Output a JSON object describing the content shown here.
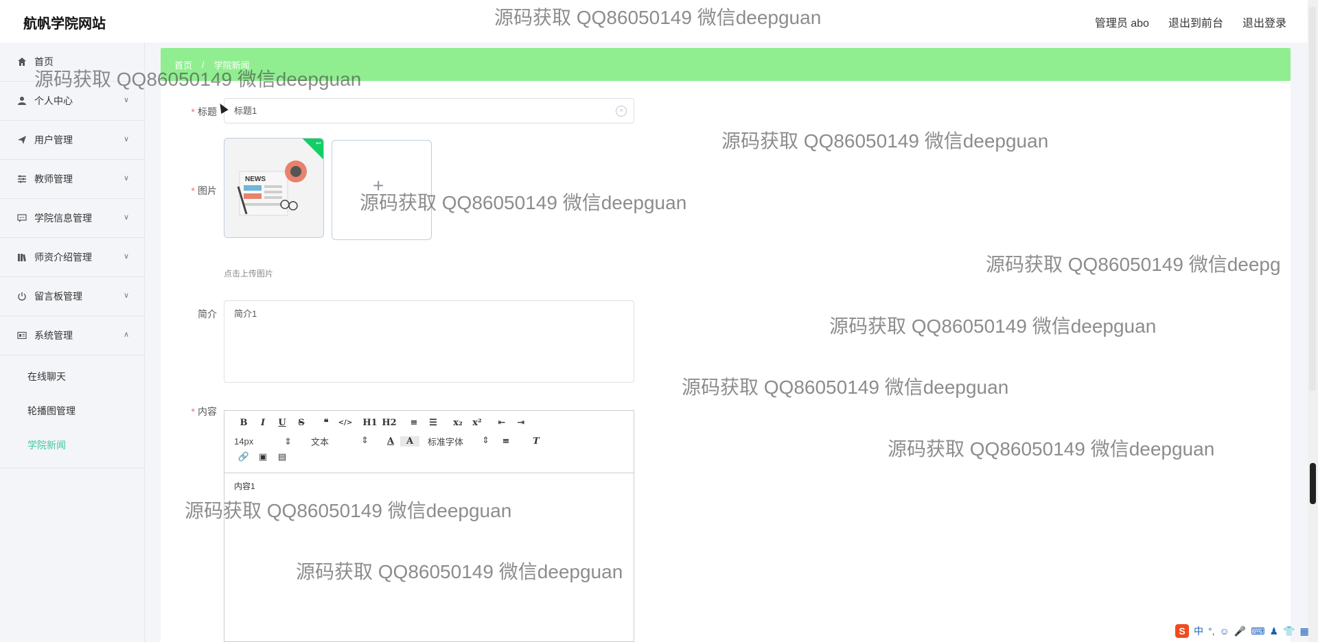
{
  "header": {
    "site_title": "航帆学院网站",
    "user_label": "管理员 abo",
    "front_link": "退出到前台",
    "logout_link": "退出登录"
  },
  "sidebar": {
    "items": [
      {
        "label": "首页",
        "icon": "home-icon"
      },
      {
        "label": "个人中心",
        "icon": "user-icon"
      },
      {
        "label": "用户管理",
        "icon": "send-icon"
      },
      {
        "label": "教师管理",
        "icon": "sliders-icon"
      },
      {
        "label": "学院信息管理",
        "icon": "chat-icon"
      },
      {
        "label": "师资介绍管理",
        "icon": "books-icon"
      },
      {
        "label": "留言板管理",
        "icon": "power-icon"
      },
      {
        "label": "系统管理",
        "icon": "id-card-icon"
      }
    ],
    "system_submenu": [
      {
        "label": "在线聊天"
      },
      {
        "label": "轮播图管理"
      },
      {
        "label": "学院新闻"
      }
    ]
  },
  "breadcrumb": {
    "home": "首页",
    "separator": "/",
    "current": "学院新闻"
  },
  "form": {
    "title_label": "标题",
    "title_value": "标题1",
    "image_label": "图片",
    "thumb_text": "NEWS",
    "upload_tip": "点击上传图片",
    "intro_label": "简介",
    "intro_value": "简介1",
    "content_label": "内容",
    "required_mark": "*"
  },
  "editor": {
    "row1": [
      "B",
      "I",
      "U",
      "S",
      "❝",
      "</>",
      "H1",
      "H2",
      "≡",
      "☰",
      "x₂",
      "x²",
      "⇤",
      "⇥"
    ],
    "font_size": "14px",
    "text_type": "文本",
    "font_family": "标准字体",
    "content": "内容1"
  },
  "watermarks": [
    "源码获取 QQ86050149 微信deepguan",
    "源码获取 QQ86050149 微信deepguan",
    "源码获取 QQ86050149 微信deepguan",
    "源码获取 QQ86050149 微信deepguan",
    "源码获取 QQ86050149 微信deepg",
    "源码获取 QQ86050149 微信deepguan",
    "源码获取 QQ86050149 微信deepguan",
    "源码获取 QQ86050149 微信deepguan",
    "源码获取 QQ86050149 微信deepguan",
    "源码获取 QQ86050149 微信deepguan"
  ],
  "ime": {
    "mode": "中"
  },
  "colors": {
    "breadcrumb_bg": "#90ee90",
    "active_menu": "#3cc9a0",
    "required": "#f56c6c",
    "badge": "#13ce66"
  }
}
